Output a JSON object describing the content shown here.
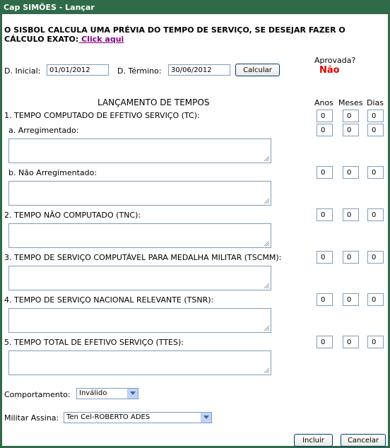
{
  "window": {
    "title": "Cap SIMÕES - Lançar"
  },
  "notice": {
    "line1": "O SISBOL CALCULA UMA PRÉVIA DO TEMPO DE SERVIÇO, SE DESEJAR FAZER O",
    "line2": "CÁLCULO EXATO:",
    "link": " Click aqui"
  },
  "dates": {
    "inicial_label": "D. Inicial:",
    "inicial_value": "01/01/2012",
    "termino_label": "D. Término:",
    "termino_value": "30/06/2012",
    "calc_button": "Calcular"
  },
  "approval": {
    "label": "Aprovada?",
    "value": "Não",
    "value_color": "#e00000"
  },
  "section": {
    "title": "LANÇAMENTO DE TEMPOS",
    "col_anos": "Anos",
    "col_meses": "Meses",
    "col_dias": "Dias"
  },
  "rows": [
    {
      "label": "1. TEMPO COMPUTADO DE EFETIVO SERVIÇO (TC):",
      "anos": "0",
      "meses": "0",
      "dias": "0"
    },
    {
      "label": "a. Arregimentado:",
      "anos": "0",
      "meses": "0",
      "dias": "0"
    },
    {
      "label": "b. Não Arregimentado:",
      "anos": "0",
      "meses": "0",
      "dias": "0"
    },
    {
      "label": "2. TEMPO NÃO COMPUTADO (TNC):",
      "anos": "0",
      "meses": "0",
      "dias": "0"
    },
    {
      "label": "3. TEMPO DE SERVIÇO COMPUTÁVEL PARA MEDALHA MILITAR (TSCMM):",
      "anos": "0",
      "meses": "0",
      "dias": "0"
    },
    {
      "label": "4. TEMPO DE SERVIÇO NACIONAL RELEVANTE (TSNR):",
      "anos": "0",
      "meses": "0",
      "dias": "0"
    },
    {
      "label": "5. TEMPO TOTAL DE EFETIVO SERVIÇO (TTES):",
      "anos": "0",
      "meses": "0",
      "dias": "0"
    }
  ],
  "comportamento": {
    "label": "Comportamento:",
    "value": "Inválido"
  },
  "militar": {
    "label": "Militar Assina:",
    "value": "Ten Cel-ROBERTO ADES"
  },
  "buttons": {
    "incluir": "Incluir",
    "cancelar": "Cancelar"
  }
}
